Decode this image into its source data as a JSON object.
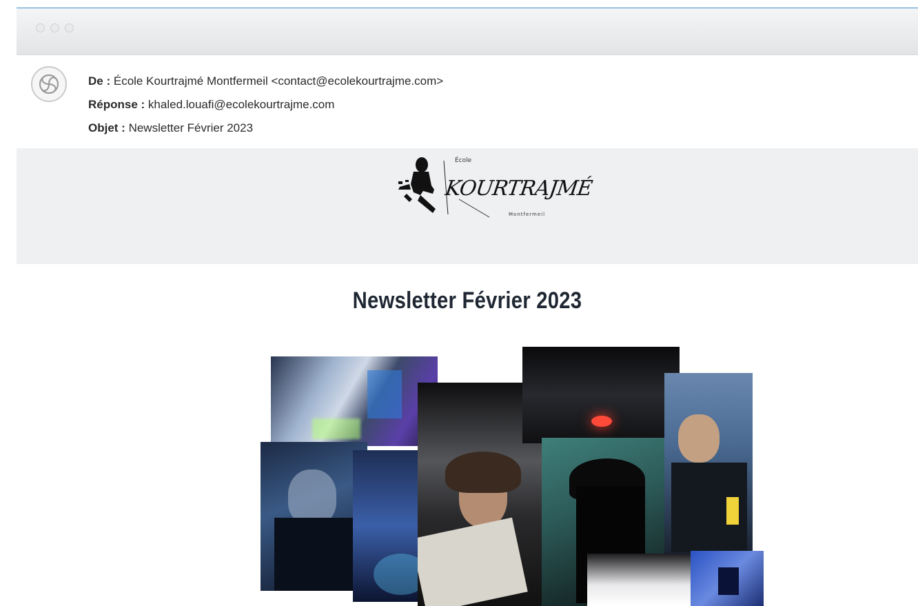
{
  "email": {
    "from_label": "De :",
    "from_value": "École Kourtrajmé Montfermeil <contact@ecolekourtrajme.com>",
    "reply_label": "Réponse :",
    "reply_value": "khaled.louafi@ecolekourtrajme.com",
    "subject_label": "Objet :",
    "subject_value": "Newsletter Février 2023"
  },
  "logo": {
    "top_text": "École",
    "brand": "KOURTRAJMÉ",
    "bottom_text": "Montfermeil"
  },
  "content": {
    "title": "Newsletter Février 2023"
  },
  "colors": {
    "accent_line": "#3b8fc9",
    "logo_band": "#eef0f2",
    "title": "#1f2733"
  }
}
